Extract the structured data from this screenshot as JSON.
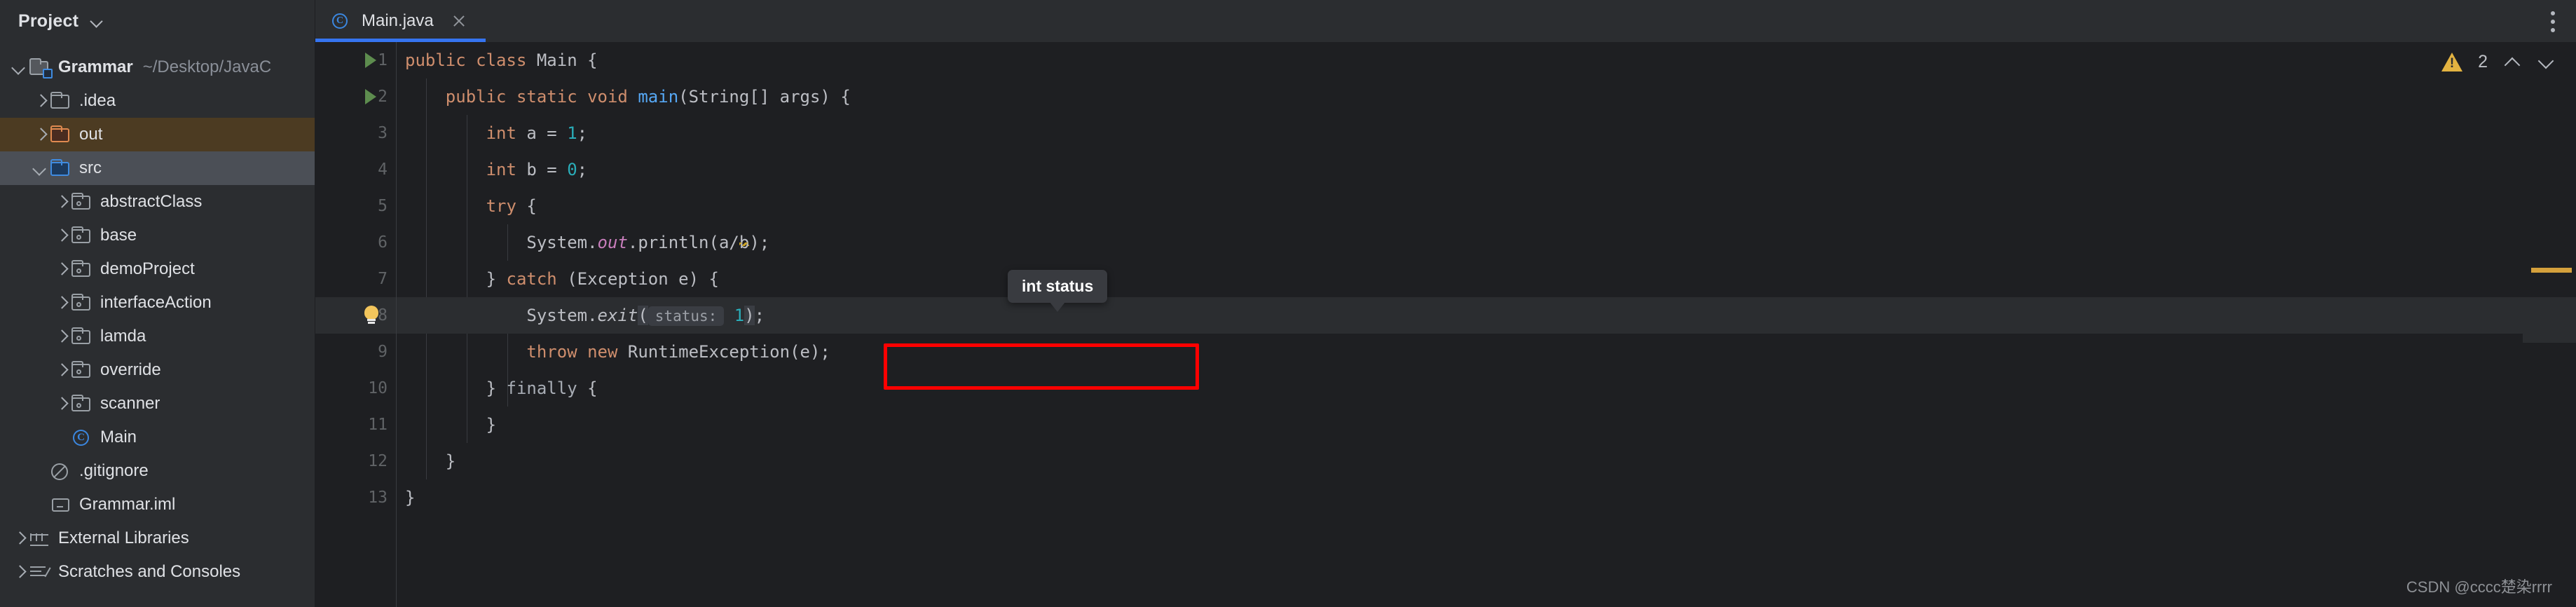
{
  "sidebar": {
    "header": {
      "title": "Project",
      "chevron_icon": "chevron-down-icon"
    },
    "items": [
      {
        "label": "Grammar",
        "path": "~/Desktop/JavaC",
        "icon": "folder-module-icon",
        "arrow": "down",
        "indent": 0,
        "state": "expanded",
        "bold": true
      },
      {
        "label": ".idea",
        "path": "",
        "icon": "folder-plain-icon",
        "arrow": "right",
        "indent": 1,
        "state": "collapsed",
        "bold": false
      },
      {
        "label": "out",
        "path": "",
        "icon": "folder-excluded-icon",
        "arrow": "right",
        "indent": 1,
        "state": "collapsed",
        "bold": false,
        "highlight": "orange"
      },
      {
        "label": "src",
        "path": "",
        "icon": "folder-source-icon",
        "arrow": "down",
        "indent": 1,
        "state": "expanded",
        "bold": false,
        "highlight": "selected"
      },
      {
        "label": "abstractClass",
        "path": "",
        "icon": "package-icon",
        "arrow": "right",
        "indent": 2,
        "state": "collapsed",
        "bold": false
      },
      {
        "label": "base",
        "path": "",
        "icon": "package-icon",
        "arrow": "right",
        "indent": 2,
        "state": "collapsed",
        "bold": false
      },
      {
        "label": "demoProject",
        "path": "",
        "icon": "package-icon",
        "arrow": "right",
        "indent": 2,
        "state": "collapsed",
        "bold": false
      },
      {
        "label": "interfaceAction",
        "path": "",
        "icon": "package-icon",
        "arrow": "right",
        "indent": 2,
        "state": "collapsed",
        "bold": false
      },
      {
        "label": "lamda",
        "path": "",
        "icon": "package-icon",
        "arrow": "right",
        "indent": 2,
        "state": "collapsed",
        "bold": false
      },
      {
        "label": "override",
        "path": "",
        "icon": "package-icon",
        "arrow": "right",
        "indent": 2,
        "state": "collapsed",
        "bold": false
      },
      {
        "label": "scanner",
        "path": "",
        "icon": "package-icon",
        "arrow": "right",
        "indent": 2,
        "state": "collapsed",
        "bold": false
      },
      {
        "label": "Main",
        "path": "",
        "icon": "java-class-icon",
        "arrow": "none",
        "indent": 2,
        "state": "leaf",
        "bold": false
      },
      {
        "label": ".gitignore",
        "path": "",
        "icon": "gitignore-icon",
        "arrow": "none",
        "indent": 1,
        "state": "leaf",
        "bold": false
      },
      {
        "label": "Grammar.iml",
        "path": "",
        "icon": "iml-file-icon",
        "arrow": "none",
        "indent": 1,
        "state": "leaf",
        "bold": false
      },
      {
        "label": "External Libraries",
        "path": "",
        "icon": "library-icon",
        "arrow": "right",
        "indent": 0,
        "state": "collapsed",
        "bold": false
      },
      {
        "label": "Scratches and Consoles",
        "path": "",
        "icon": "scratches-icon",
        "arrow": "right",
        "indent": 0,
        "state": "collapsed",
        "bold": false
      }
    ]
  },
  "tabs": [
    {
      "label": "Main.java",
      "icon": "java-class-icon",
      "close_icon": "close-icon",
      "active": true
    }
  ],
  "toolbar": {
    "kebab_icon": "more-options-icon"
  },
  "inspections": {
    "warning_icon": "warning-triangle-icon",
    "count": "2",
    "prev_icon": "chevron-up-icon",
    "next_icon": "chevron-down-icon"
  },
  "editor": {
    "language": "java",
    "current_line": 8,
    "lines": [
      {
        "n": "1",
        "gutter": "run-marker",
        "text": "public class Main {"
      },
      {
        "n": "2",
        "gutter": "run-marker",
        "text": "    public static void main(String[] args) {"
      },
      {
        "n": "3",
        "gutter": "",
        "text": "        int a = 1;"
      },
      {
        "n": "4",
        "gutter": "",
        "text": "        int b = 0;"
      },
      {
        "n": "5",
        "gutter": "",
        "text": "        try {"
      },
      {
        "n": "6",
        "gutter": "",
        "text": "            System.out.println(a/b);"
      },
      {
        "n": "7",
        "gutter": "",
        "text": "        } catch (Exception e) {"
      },
      {
        "n": "8",
        "gutter": "intention-bulb",
        "text": "            System.exit( status: 1);"
      },
      {
        "n": "9",
        "gutter": "",
        "text": "            throw new RuntimeException(e);"
      },
      {
        "n": "10",
        "gutter": "",
        "text": "        } finally {"
      },
      {
        "n": "11",
        "gutter": "",
        "text": "        }"
      },
      {
        "n": "12",
        "gutter": "",
        "text": "    }"
      },
      {
        "n": "13",
        "gutter": "",
        "text": "}"
      }
    ],
    "inlay_hint": "status:",
    "tooltip": {
      "text": "int status"
    }
  },
  "annotation": {
    "type": "red-rectangle",
    "target_line": 8,
    "color": "#FF0000"
  },
  "watermark": {
    "text": "CSDN @cccc楚染rrrr"
  },
  "colors": {
    "background": "#1E1F22",
    "panel": "#2B2D30",
    "accent": "#3574F0",
    "keyword": "#CF8E6D",
    "number": "#2AACB8",
    "method": "#56A8F5",
    "static_field": "#C77DBB",
    "text": "#BCBEC4",
    "warning": "#E3B341",
    "excluded_folder": "#E08A50",
    "source_folder": "#3F8BE0",
    "annotation_red": "#FF0000"
  }
}
